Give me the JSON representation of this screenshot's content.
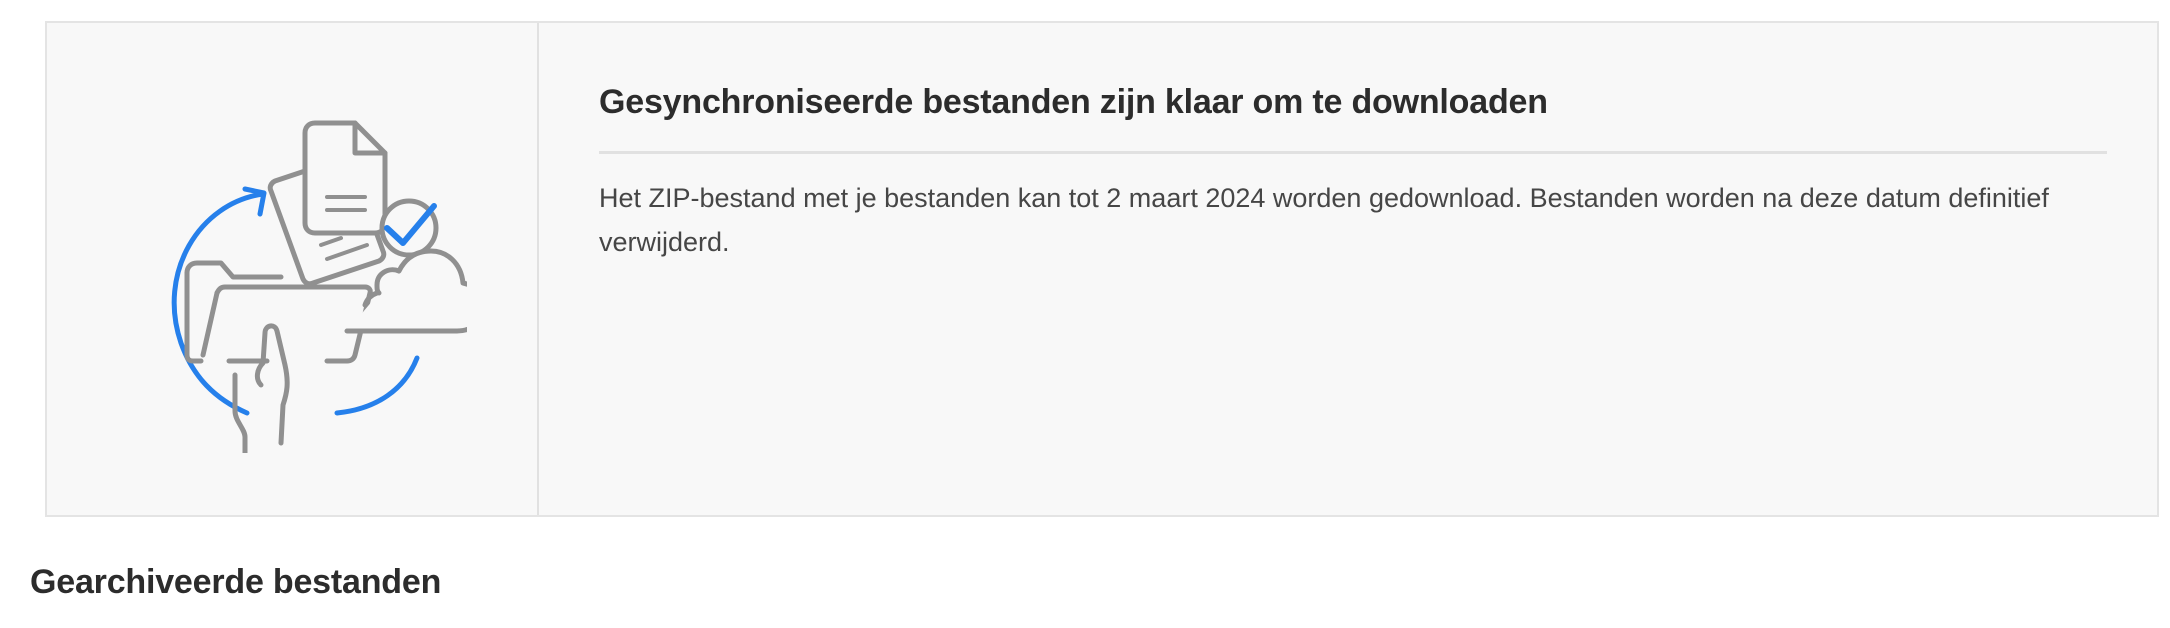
{
  "notice": {
    "illustration_icon": "file-sync-cloud-illustration",
    "title": "Gesynchroniseerde bestanden zijn klaar om te downloaden",
    "body": "Het ZIP-bestand met je bestanden kan tot 2 maart 2024 worden gedownload. Bestanden worden na deze datum definitief verwijderd."
  },
  "section": {
    "heading": "Gearchiveerde bestanden"
  },
  "colors": {
    "accent_blue": "#2680eb",
    "icon_gray": "#909090",
    "card_background": "#f8f8f8",
    "text": "#2c2c2c"
  }
}
